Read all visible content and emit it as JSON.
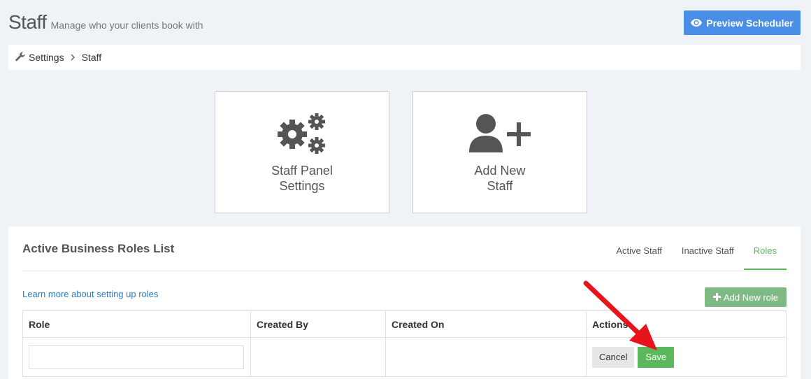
{
  "header": {
    "title": "Staff",
    "subtitle": "Manage who your clients book with",
    "preview_button": "Preview Scheduler"
  },
  "breadcrumb": {
    "items": [
      "Settings",
      "Staff"
    ]
  },
  "cards": [
    {
      "label": "Staff Panel Settings",
      "icon": "gears-icon"
    },
    {
      "label": "Add New Staff",
      "icon": "user-plus-icon"
    }
  ],
  "panel": {
    "title": "Active Business Roles List",
    "tabs": [
      "Active Staff",
      "Inactive Staff",
      "Roles"
    ],
    "active_tab": "Roles",
    "learn_link": "Learn more about setting up roles",
    "add_role_button": "Add New role"
  },
  "table": {
    "columns": [
      "Role",
      "Created By",
      "Created On",
      "Actions"
    ],
    "new_row": {
      "role_value": "",
      "created_by": "",
      "created_on": "",
      "cancel_label": "Cancel",
      "save_label": "Save"
    }
  },
  "colors": {
    "primary": "#4a8fe7",
    "success": "#5cb85c",
    "add_role": "#7fba84",
    "link": "#2a7bc4",
    "arrow": "#e8141b"
  }
}
